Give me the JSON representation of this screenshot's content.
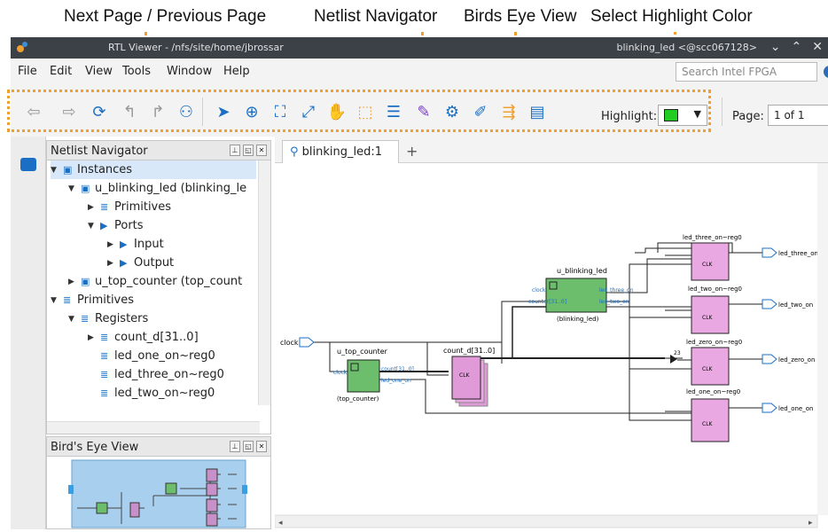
{
  "callouts": {
    "next_prev": "Next Page / Previous Page",
    "netlist": "Netlist Navigator",
    "birds": "Birds Eye View",
    "highlight": "Select Highlight Color"
  },
  "window": {
    "title": "RTL Viewer - /nfs/site/home/jbrossar",
    "right_title": "blinking_led <@scc067128>"
  },
  "menu": {
    "items": [
      "File",
      "Edit",
      "View",
      "Tools",
      "Window",
      "Help"
    ],
    "search_placeholder": "Search Intel FPGA"
  },
  "toolbar": {
    "highlight_label": "Highlight:",
    "highlight_color": "#22cc22",
    "page_label": "Page:",
    "page_value": "1 of 1"
  },
  "netlist": {
    "title": "Netlist Navigator",
    "rows": [
      {
        "label": "Instances"
      },
      {
        "label": "u_blinking_led (blinking_le"
      },
      {
        "label": "Primitives"
      },
      {
        "label": "Ports"
      },
      {
        "label": "Input"
      },
      {
        "label": "Output"
      },
      {
        "label": "u_top_counter (top_count"
      },
      {
        "label": "Primitives"
      },
      {
        "label": "Registers"
      },
      {
        "label": "count_d[31..0]"
      },
      {
        "label": "led_one_on~reg0"
      },
      {
        "label": "led_three_on~reg0"
      },
      {
        "label": "led_two_on~reg0"
      }
    ]
  },
  "birdseye": {
    "title": "Bird's Eye View"
  },
  "tab": {
    "label": "blinking_led:1",
    "plus": "+"
  },
  "schematic": {
    "clock": "clock",
    "top_counter": "u_top_counter",
    "top_counter_sub": "(top_counter)",
    "tc_clock": "clock",
    "tc_count": "count[31..0]",
    "tc_led": "led_one_on",
    "count_d": "count_d[31..0]",
    "clk": "CLK",
    "blinking": "u_blinking_led",
    "blinking_sub": "(blinking_led)",
    "bl_clock": "clock",
    "bl_counter": "counter[31..0]",
    "bl_three": "led_three_on",
    "bl_two": "led_two_on",
    "reg_three": "led_three_on~reg0",
    "reg_two": "led_two_on~reg0",
    "reg_zero": "led_zero_on~reg0",
    "reg_one": "led_one_on~reg0",
    "out_three": "led_three_on",
    "out_two": "led_two_on",
    "out_zero": "led_zero_on",
    "out_one": "led_one_on",
    "bus23": "23"
  }
}
